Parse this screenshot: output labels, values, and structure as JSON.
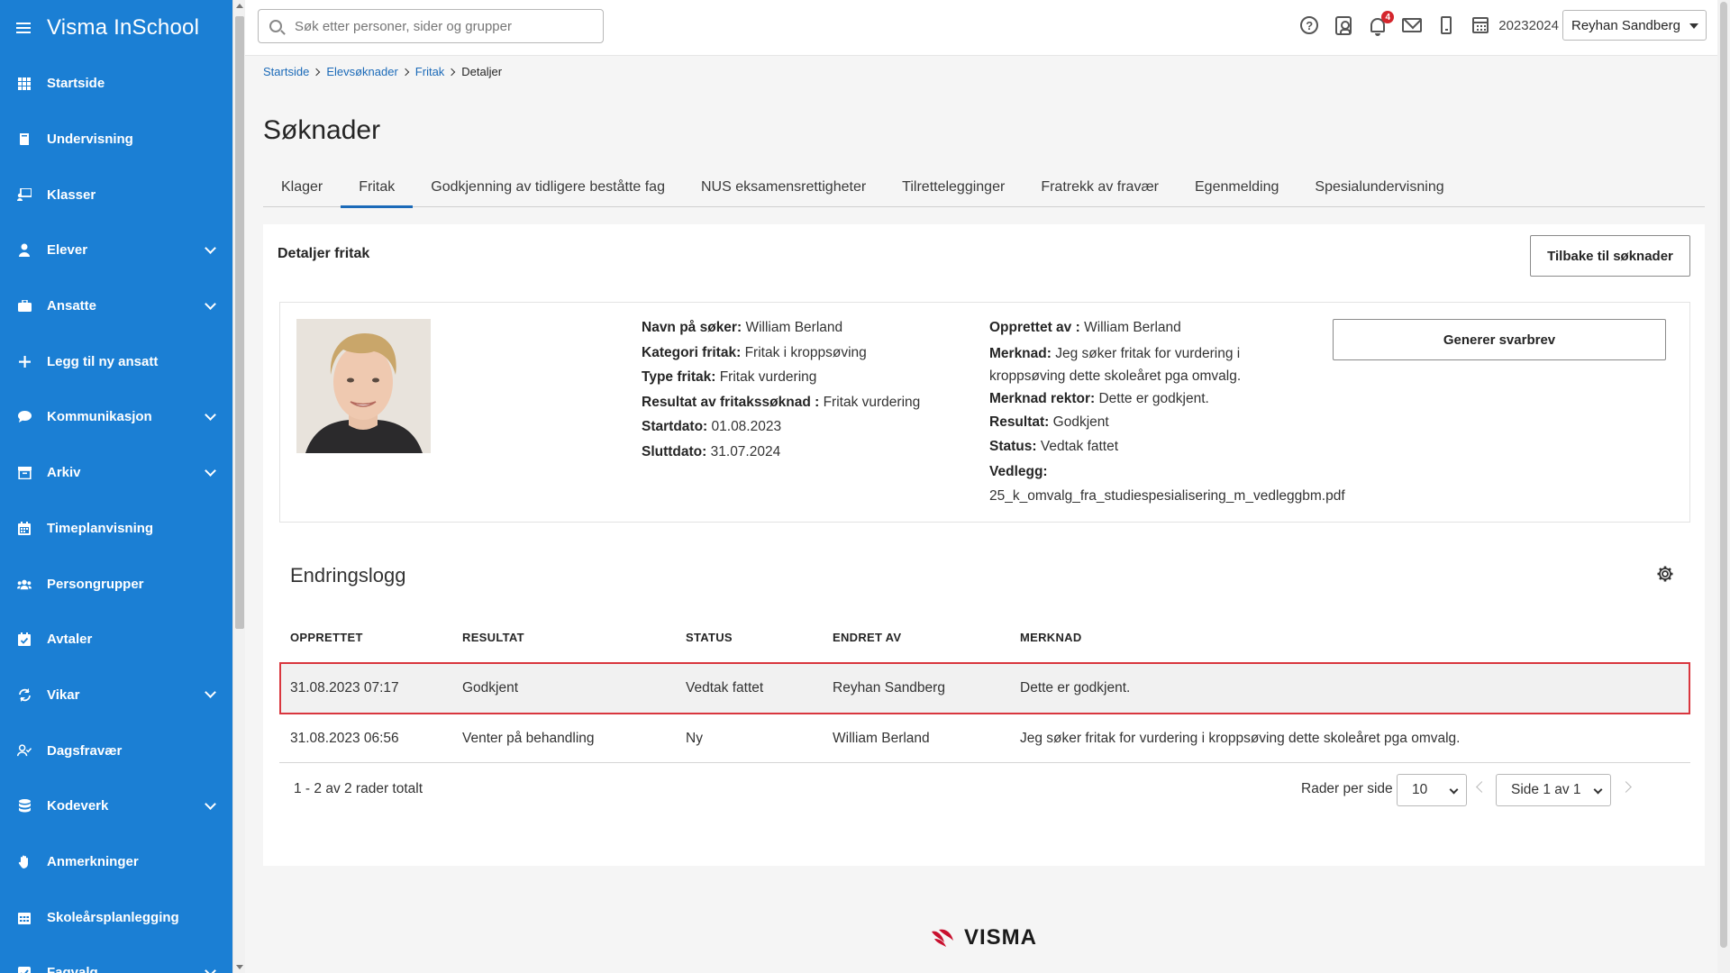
{
  "app": {
    "title": "Visma InSchool",
    "brand_color": "#1b7fd4",
    "footer_logo": "VISMA"
  },
  "sidebar": {
    "items": [
      {
        "label": "Startside",
        "icon": "grid-icon",
        "expandable": false
      },
      {
        "label": "Undervisning",
        "icon": "book-icon",
        "expandable": false
      },
      {
        "label": "Klasser",
        "icon": "classroom-icon",
        "expandable": false
      },
      {
        "label": "Elever",
        "icon": "student-icon",
        "expandable": true
      },
      {
        "label": "Ansatte",
        "icon": "briefcase-icon",
        "expandable": true
      },
      {
        "label": "Legg til ny ansatt",
        "icon": "plus-icon",
        "expandable": false
      },
      {
        "label": "Kommunikasjon",
        "icon": "chat-icon",
        "expandable": true
      },
      {
        "label": "Arkiv",
        "icon": "archive-icon",
        "expandable": true
      },
      {
        "label": "Timeplanvisning",
        "icon": "calendar-icon",
        "expandable": false
      },
      {
        "label": "Persongrupper",
        "icon": "group-icon",
        "expandable": false
      },
      {
        "label": "Avtaler",
        "icon": "calendar-check-icon",
        "expandable": false
      },
      {
        "label": "Vikar",
        "icon": "sync-icon",
        "expandable": true
      },
      {
        "label": "Dagsfravær",
        "icon": "user-check-icon",
        "expandable": false
      },
      {
        "label": "Kodeverk",
        "icon": "database-icon",
        "expandable": true
      },
      {
        "label": "Anmerkninger",
        "icon": "hand-icon",
        "expandable": false
      },
      {
        "label": "Skoleårsplanlegging",
        "icon": "calendar-grid-icon",
        "expandable": false
      },
      {
        "label": "Fagvalg",
        "icon": "checkbox-icon",
        "expandable": true
      }
    ]
  },
  "topbar": {
    "search_placeholder": "Søk etter personer, sider og grupper",
    "notification_count": "4",
    "school_year": "20232024",
    "user_name": "Reyhan Sandberg"
  },
  "breadcrumb": {
    "items": [
      "Startside",
      "Elevsøknader",
      "Fritak"
    ],
    "current": "Detaljer"
  },
  "page": {
    "title": "Søknader",
    "tabs": [
      {
        "label": "Klager",
        "active": false
      },
      {
        "label": "Fritak",
        "active": true
      },
      {
        "label": "Godkjenning av tidligere beståtte fag",
        "active": false
      },
      {
        "label": "NUS eksamensrettigheter",
        "active": false
      },
      {
        "label": "Tilrettelegginger",
        "active": false
      },
      {
        "label": "Fratrekk av fravær",
        "active": false
      },
      {
        "label": "Egenmelding",
        "active": false
      },
      {
        "label": "Spesialundervisning",
        "active": false
      }
    ]
  },
  "details": {
    "card_title": "Detaljer fritak",
    "back_button": "Tilbake til søknader",
    "generate_button": "Generer svarbrev",
    "fields_left": [
      {
        "label": "Navn på søker:",
        "value": "William Berland"
      },
      {
        "label": "Kategori fritak:",
        "value": "Fritak i kroppsøving"
      },
      {
        "label": "Type fritak:",
        "value": "Fritak vurdering"
      },
      {
        "label": "Resultat av fritakssøknad :",
        "value": "Fritak vurdering"
      },
      {
        "label": "Startdato:",
        "value": "01.08.2023"
      },
      {
        "label": "Sluttdato:",
        "value": "31.07.2024"
      }
    ],
    "fields_right": {
      "created_by_label": "Opprettet av :",
      "created_by": "William Berland",
      "note_label": "Merknad:",
      "note_line1": "Jeg søker fritak for vurdering i",
      "note_line2": "kroppsøving dette skoleåret pga omvalg.",
      "principal_note_label": "Merknad rektor:",
      "principal_note": "Dette er godkjent.",
      "result_label": "Resultat:",
      "result": "Godkjent",
      "status_label": "Status:",
      "status": "Vedtak fattet",
      "attachment_label": "Vedlegg:",
      "attachment": "25_k_omvalg_fra_studiespesialisering_m_vedleggbm.pdf"
    }
  },
  "changelog": {
    "title": "Endringslogg",
    "columns": [
      "OPPRETTET",
      "RESULTAT",
      "STATUS",
      "ENDRET AV",
      "MERKNAD"
    ],
    "rows": [
      {
        "created": "31.08.2023 07:17",
        "result": "Godkjent",
        "status": "Vedtak fattet",
        "changed_by": "Reyhan Sandberg",
        "note": "Dette er godkjent.",
        "highlighted": true
      },
      {
        "created": "31.08.2023 06:56",
        "result": "Venter på behandling",
        "status": "Ny",
        "changed_by": "William Berland",
        "note": "Jeg søker fritak for vurdering i kroppsøving dette skoleåret pga omvalg.",
        "highlighted": false
      }
    ],
    "total_text": "1 - 2 av 2 rader totalt",
    "rows_per_page_label": "Rader per side",
    "rows_per_page": "10",
    "page_label": "Side 1 av 1"
  }
}
